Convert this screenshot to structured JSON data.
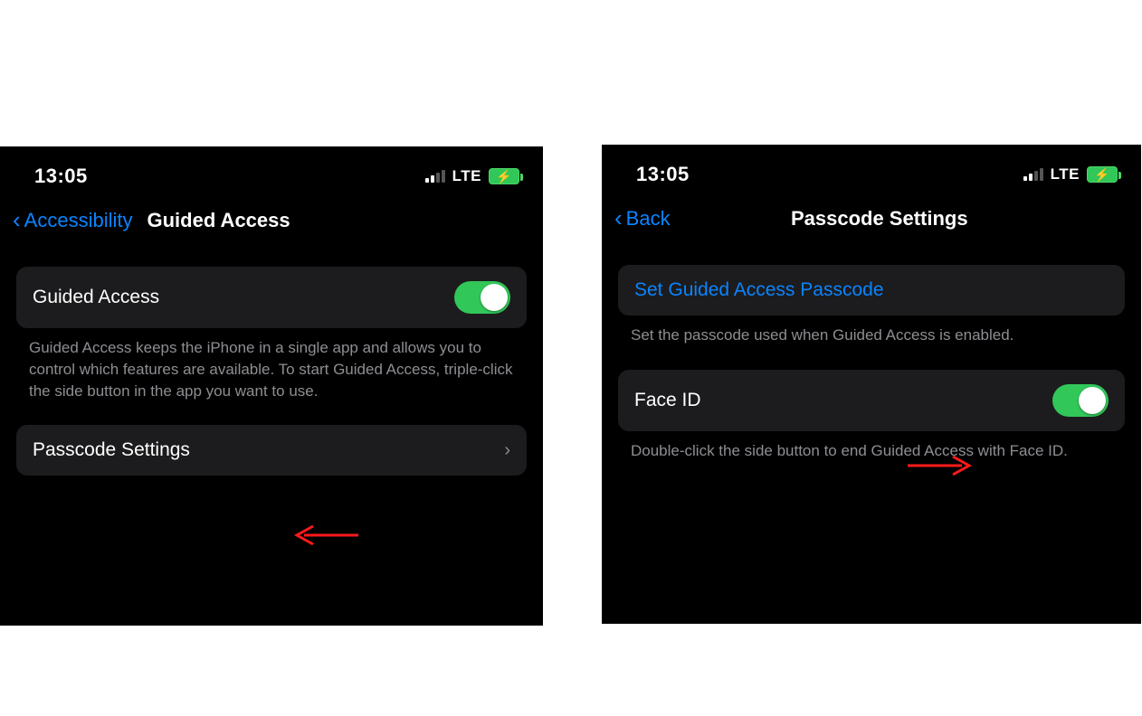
{
  "left": {
    "statusbar": {
      "time": "13:05",
      "lte": "LTE"
    },
    "nav": {
      "back": "Accessibility",
      "title": "Guided Access"
    },
    "rows": {
      "guided_access": "Guided Access",
      "guided_access_desc": "Guided Access keeps the iPhone in a single app and allows you to control which features are available. To start Guided Access, triple-click the side button in the app you want to use.",
      "passcode_settings": "Passcode Settings"
    }
  },
  "right": {
    "statusbar": {
      "time": "13:05",
      "lte": "LTE"
    },
    "nav": {
      "back": "Back",
      "title": "Passcode Settings"
    },
    "rows": {
      "set_passcode": "Set Guided Access Passcode",
      "set_passcode_desc": "Set the passcode used when Guided Access is enabled.",
      "face_id": "Face ID",
      "face_id_desc": "Double-click the side button to end Guided Access with Face ID."
    }
  }
}
